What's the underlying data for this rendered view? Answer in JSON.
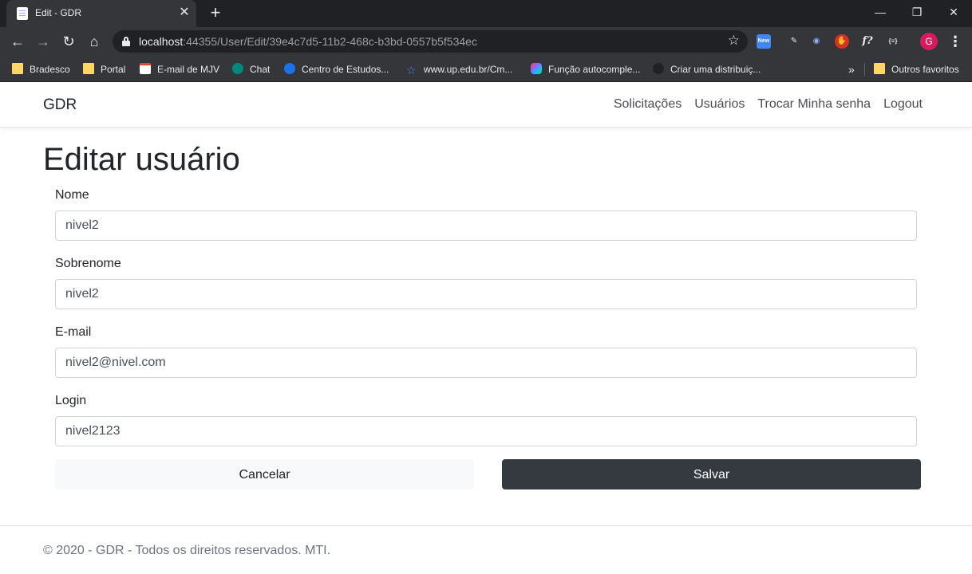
{
  "browser": {
    "tab_title": "Edit - GDR",
    "url_host": "localhost",
    "url_rest": ":44355/User/Edit/39e4c7d5-11b2-468c-b3bd-0557b5f534ec",
    "profile_initial": "G",
    "window_controls": [
      "—",
      "❐",
      "✕"
    ],
    "extensions": [
      {
        "name": "new-extension-icon",
        "label": "New",
        "color": "#4285f4"
      },
      {
        "name": "pen-extension-icon",
        "label": "✎",
        "color": "#35363a"
      },
      {
        "name": "shield-extension-icon",
        "label": "◉",
        "color": "#35363a"
      },
      {
        "name": "hand-extension-icon",
        "label": "✋",
        "color": "#d93025"
      },
      {
        "name": "function-extension-icon",
        "label": "f?",
        "color": "#35363a"
      },
      {
        "name": "json-extension-icon",
        "label": "{≡}",
        "color": "#35363a"
      }
    ],
    "bookmarks": [
      {
        "label": "Bradesco",
        "icon": "folder"
      },
      {
        "label": "Portal",
        "icon": "folder"
      },
      {
        "label": "E-mail de MJV",
        "icon": "gmail"
      },
      {
        "label": "Chat",
        "icon": "chat"
      },
      {
        "label": "Centro de Estudos...",
        "icon": "cem"
      },
      {
        "label": "www.up.edu.br/Cm...",
        "icon": "star"
      },
      {
        "label": "Função autocomple...",
        "icon": "figma"
      },
      {
        "label": "Criar uma distribuiç...",
        "icon": "cloud"
      }
    ],
    "bookmarks_more": "»",
    "other_bookmarks": "Outros favoritos"
  },
  "navbar": {
    "brand": "GDR",
    "links": [
      "Solicitações",
      "Usuários",
      "Trocar Minha senha",
      "Logout"
    ]
  },
  "page": {
    "title": "Editar usuário",
    "fields": [
      {
        "label": "Nome",
        "value": "nivel2"
      },
      {
        "label": "Sobrenome",
        "value": "nivel2"
      },
      {
        "label": "E-mail",
        "value": "nivel2@nivel.com"
      },
      {
        "label": "Login",
        "value": "nivel2123"
      }
    ],
    "cancel_label": "Cancelar",
    "save_label": "Salvar"
  },
  "footer": {
    "text": "© 2020 - GDR - Todos os direitos reservados. MTI."
  }
}
